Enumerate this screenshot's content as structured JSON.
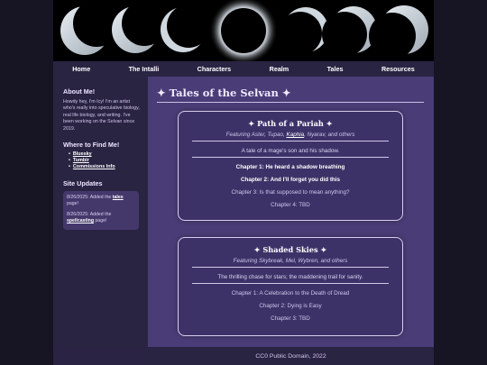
{
  "nav": [
    "Home",
    "The Intalli",
    "Characters",
    "Realm",
    "Tales",
    "Resources"
  ],
  "sidebar": {
    "about_heading": "About Me!",
    "about_text": "Howdy hey, I'm Icy! I'm an artist who's really into speculative biology, real life biology, and writing. I've been working on the Selvan since 2019.",
    "find_heading": "Where to Find Me!",
    "links": [
      "Bluesky",
      "Tumblr",
      "Commissions Info"
    ],
    "updates_heading": "Site Updates",
    "updates": [
      {
        "date": "8/26/2025:",
        "pre": "Added the",
        "link": "tales",
        "post": "page!"
      },
      {
        "date": "8/26/2025:",
        "pre": "Added the",
        "link": "spellcasting",
        "post": "page!"
      }
    ]
  },
  "main": {
    "title": "✦ Tales of the Selvan ✦",
    "cards": [
      {
        "title": "✦ Path of a Pariah ✦",
        "featuring_pre": "Featuring Aster, Tupao, ",
        "featuring_link": "Kaphia",
        "featuring_post": ", Nyarav, and others",
        "description": "A tale of a mage's son and his shadow.",
        "chapters": [
          {
            "label": "Chapter 1: He heard a shadow breathing",
            "bold": true
          },
          {
            "label": "Chapter 2: And I'll forget you did this",
            "bold": true
          },
          {
            "label": "Chapter 3: Is that supposed to mean anything?",
            "bold": false
          },
          {
            "label": "Chapter 4: TBD",
            "bold": false
          }
        ]
      },
      {
        "title": "✦ Shaded Skies ✦",
        "featuring_pre": "Featuring Skybreak, Mel, Wybren, and others",
        "featuring_link": "",
        "featuring_post": "",
        "description": "The thrilling chase for stars; the maddening trail for sanity.",
        "chapters": [
          {
            "label": "Chapter 1: A Celebration to the Death of Dread",
            "bold": false
          },
          {
            "label": "Chapter 2: Dying is Easy",
            "bold": false
          },
          {
            "label": "Chapter 3: TBD",
            "bold": false
          }
        ]
      }
    ]
  },
  "footer": "CC0 Public Domain, 2022",
  "colors": {
    "page_bg": "#171423",
    "panel": "#2a2443",
    "main_bg": "#4a3d77",
    "card_bg": "#3d3268"
  }
}
